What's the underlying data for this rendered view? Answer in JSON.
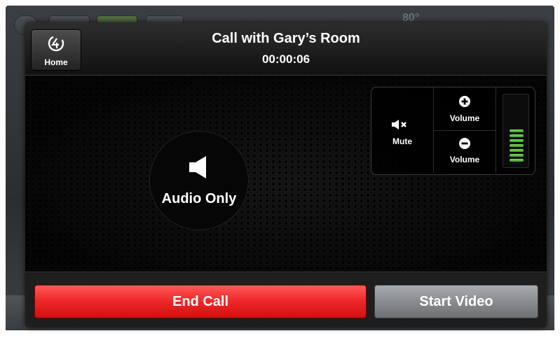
{
  "background": {
    "temperature_partial": "80°"
  },
  "header": {
    "home_label": "Home",
    "call_title": "Call with Gary’s Room",
    "call_timer": "00:00:06"
  },
  "main": {
    "audio_label": "Audio Only",
    "icon": "speaker-icon"
  },
  "volume_panel": {
    "mute_label": "Mute",
    "volume_up_label": "Volume",
    "volume_down_label": "Volume",
    "level_bars_lit": 7
  },
  "footer": {
    "end_call_label": "End Call",
    "start_video_label": "Start Video"
  },
  "colors": {
    "end_call": "#f02a2a",
    "start_video": "#8d9093",
    "meter": "#7ee05a"
  }
}
